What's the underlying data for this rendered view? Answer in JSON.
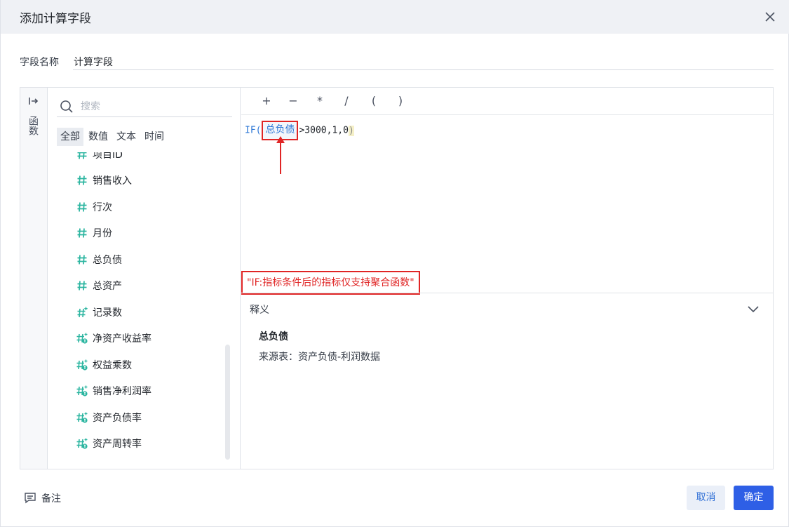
{
  "dialog": {
    "title": "添加计算字段",
    "close_icon": "close-icon"
  },
  "name_field": {
    "label": "字段名称",
    "value": "计算字段"
  },
  "function_panel": {
    "icon": "collapse-arrow-icon",
    "label": "函数"
  },
  "search": {
    "placeholder": "搜索",
    "icon": "search-icon"
  },
  "filter_tabs": [
    {
      "label": "全部",
      "active": true
    },
    {
      "label": "数值",
      "active": false
    },
    {
      "label": "文本",
      "active": false
    },
    {
      "label": "时间",
      "active": false
    }
  ],
  "fields": [
    {
      "label": "项目ID",
      "icon": "number-field-icon"
    },
    {
      "label": "销售收入",
      "icon": "number-field-icon"
    },
    {
      "label": "行次",
      "icon": "number-field-icon"
    },
    {
      "label": "月份",
      "icon": "number-field-icon"
    },
    {
      "label": "总负债",
      "icon": "number-field-icon"
    },
    {
      "label": "总资产",
      "icon": "number-field-icon"
    },
    {
      "label": "记录数",
      "icon": "calculated-field-icon"
    },
    {
      "label": "净资产收益率",
      "icon": "formula-field-icon"
    },
    {
      "label": "权益乘数",
      "icon": "formula-field-icon"
    },
    {
      "label": "销售净利润率",
      "icon": "formula-field-icon"
    },
    {
      "label": "资产负债率",
      "icon": "formula-field-icon"
    },
    {
      "label": "资产周转率",
      "icon": "formula-field-icon"
    }
  ],
  "operators": [
    "+",
    "−",
    "*",
    "/",
    "(",
    ")"
  ],
  "formula": {
    "func": "IF(",
    "field_token": "总负债",
    "rest": ">3000,1,0",
    "close": ")"
  },
  "error_message": "\"IF:指标条件后的指标仅支持聚合函数\"",
  "explain": {
    "title": "释义",
    "toggle_icon": "chevron-down-icon",
    "field_name": "总负债",
    "source": "来源表：资产负债-利润数据"
  },
  "footer": {
    "remark_label": "备注",
    "remark_icon": "comment-icon",
    "cancel_label": "取消",
    "ok_label": "确定"
  },
  "colors": {
    "accent": "#2e5fe6",
    "error": "#e02525",
    "field_icon": "#2bb5a0"
  }
}
